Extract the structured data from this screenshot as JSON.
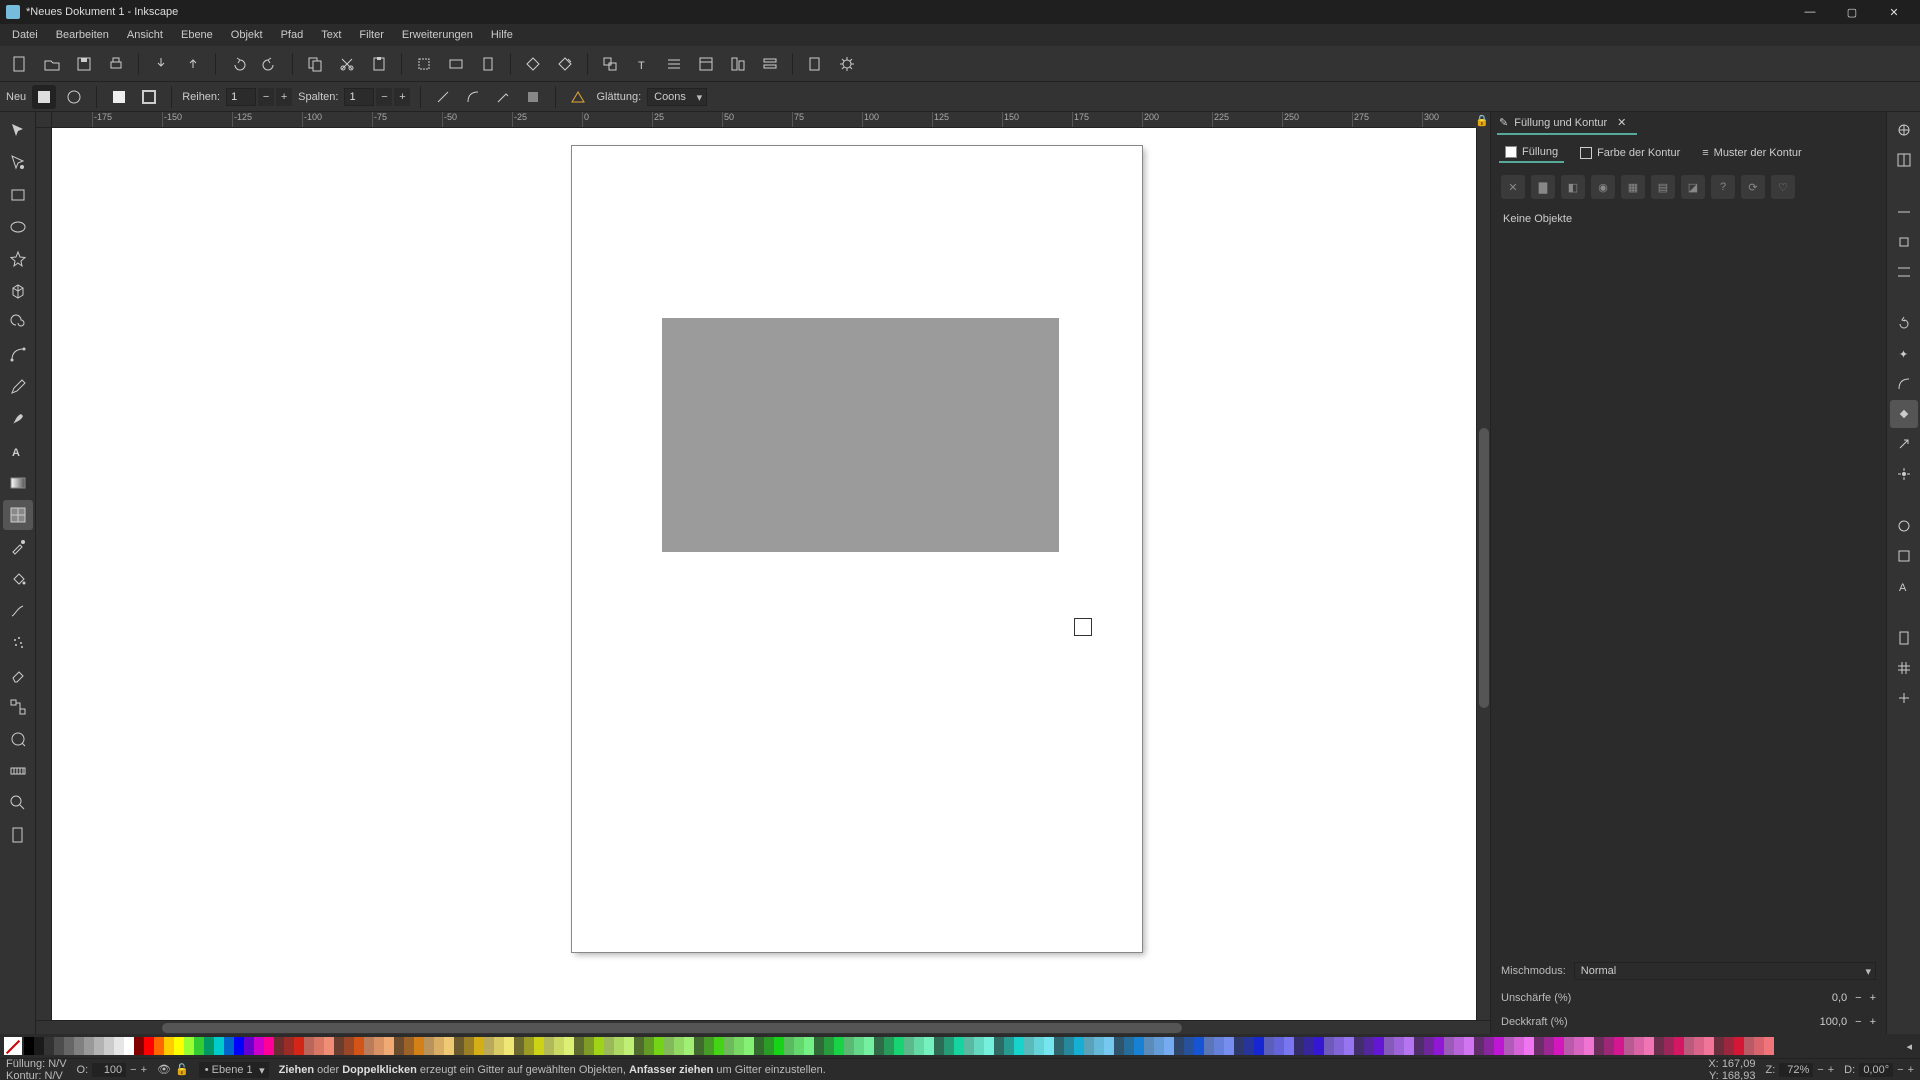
{
  "window": {
    "title": "*Neues Dokument 1 - Inkscape"
  },
  "menu": [
    "Datei",
    "Bearbeiten",
    "Ansicht",
    "Ebene",
    "Objekt",
    "Pfad",
    "Text",
    "Filter",
    "Erweiterungen",
    "Hilfe"
  ],
  "tooloptions": {
    "neu": "Neu",
    "reihen_label": "Reihen:",
    "reihen_value": "1",
    "spalten_label": "Spalten:",
    "spalten_value": "1",
    "glaettung_label": "Glättung:",
    "glaettung_value": "Coons"
  },
  "ruler_ticks_h": [
    -175,
    -150,
    -125,
    -100,
    -75,
    -50,
    -25,
    0,
    25,
    50,
    75,
    100,
    125,
    150,
    175,
    200,
    225,
    250,
    275,
    300
  ],
  "dock": {
    "tab_title": "Füllung und Kontur",
    "subtabs": {
      "fill": "Füllung",
      "stroke": "Farbe der Kontur",
      "pattern": "Muster der Kontur"
    },
    "no_objects": "Keine Objekte",
    "blend_label": "Mischmodus:",
    "blend_value": "Normal",
    "blur_label": "Unschärfe (%)",
    "blur_value": "0,0",
    "opacity_label": "Deckkraft (%)",
    "opacity_value": "100,0"
  },
  "palette_greys": [
    "#000000",
    "#1a1a1a",
    "#333333",
    "#4d4d4d",
    "#666666",
    "#808080",
    "#999999",
    "#b3b3b3",
    "#cccccc",
    "#e6e6e6",
    "#ffffff"
  ],
  "palette_pure": [
    "#800000",
    "#ff0000",
    "#ff6600",
    "#ffcc00",
    "#ffff00",
    "#99ff33",
    "#33cc33",
    "#009966",
    "#00cccc",
    "#0066cc",
    "#0000ff",
    "#6600cc",
    "#cc00cc",
    "#ff0099"
  ],
  "status": {
    "fill_label": "Füllung:",
    "fill_value": "N/V",
    "stroke_label": "Kontur:",
    "stroke_value": "N/V",
    "o_label": "O:",
    "o_value": "100",
    "layer": "Ebene 1",
    "hint_drag": "Ziehen",
    "hint_or": " oder ",
    "hint_dbl": "Doppelklicken",
    "hint_mid": " erzeugt ein Gitter auf gewählten Objekten, ",
    "hint_grab": "Anfasser ziehen",
    "hint_end": " um Gitter einzustellen.",
    "x_label": "X:",
    "x_value": "167,09",
    "y_label": "Y:",
    "y_value": "168,93",
    "z_label": "Z:",
    "z_value": "72%",
    "d_label": "D:",
    "d_value": "0,00°"
  }
}
